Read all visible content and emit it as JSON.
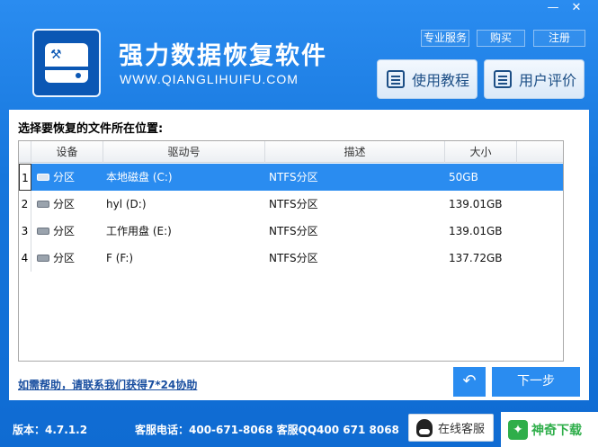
{
  "window": {
    "minimize_glyph": "—",
    "close_glyph": "✕"
  },
  "brand": {
    "title": "强力数据恢复软件",
    "url": "WWW.QIANGLIHUIFU.COM",
    "logo_icon": "hard-drive-wrench-icon"
  },
  "top_links": {
    "pro_service": "专业服务",
    "buy": "购买",
    "register": "注册"
  },
  "big_buttons": {
    "tutorial": "使用教程",
    "review": "用户评价"
  },
  "main": {
    "prompt": "选择要恢复的文件所在位置:",
    "columns": [
      "设备",
      "驱动号",
      "描述",
      "大小"
    ],
    "rows": [
      {
        "num": "1",
        "device": "分区",
        "drive": "本地磁盘 (C:)",
        "desc": "NTFS分区",
        "size": "50GB",
        "selected": true
      },
      {
        "num": "2",
        "device": "分区",
        "drive": "hyl (D:)",
        "desc": "NTFS分区",
        "size": "139.01GB",
        "selected": false
      },
      {
        "num": "3",
        "device": "分区",
        "drive": "工作用盘 (E:)",
        "desc": "NTFS分区",
        "size": "139.01GB",
        "selected": false
      },
      {
        "num": "4",
        "device": "分区",
        "drive": "F (F:)",
        "desc": "NTFS分区",
        "size": "137.72GB",
        "selected": false
      }
    ],
    "help_link": "如需帮助，请联系我们获得7*24协助",
    "back_glyph": "↶",
    "next_label": "下一步"
  },
  "footer": {
    "version": "版本：4.7.1.2",
    "service": "客服电话：400-671-8068 客服QQ400 671 8068",
    "online_service": "在线客服",
    "badge_text": "神奇下载"
  },
  "colors": {
    "accent": "#2a8cf0",
    "background": "#1676dc",
    "badge_green": "#2fae4a"
  }
}
